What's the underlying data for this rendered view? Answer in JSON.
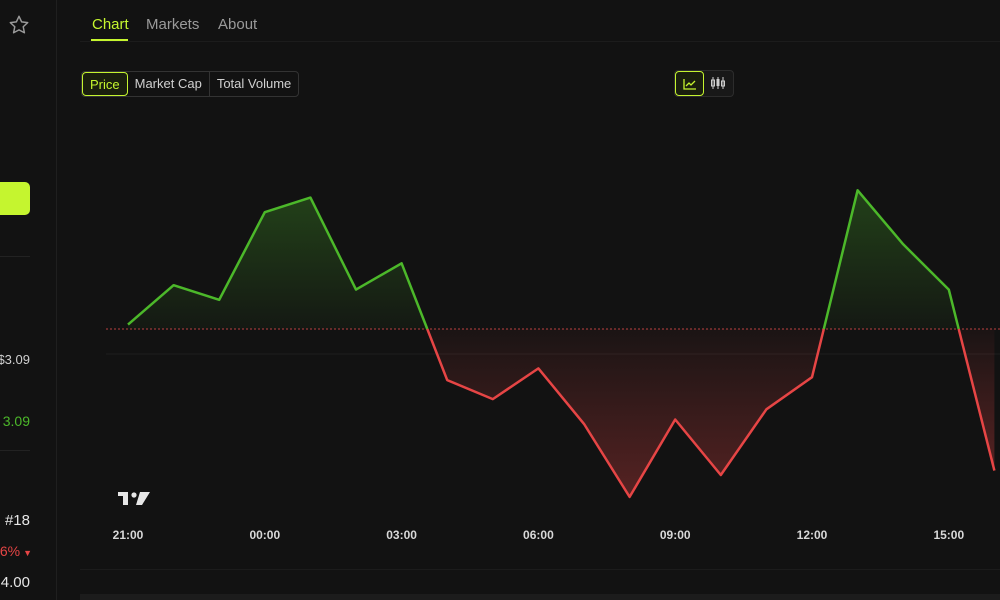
{
  "tabs": [
    {
      "label": "Chart",
      "active": true
    },
    {
      "label": "Markets",
      "active": false
    },
    {
      "label": "About",
      "active": false
    }
  ],
  "metric_toggle": [
    {
      "label": "Price",
      "active": true
    },
    {
      "label": "Market Cap",
      "active": false
    },
    {
      "label": "Total Volume",
      "active": false
    }
  ],
  "chart_type_toggle": {
    "line_icon": "line-chart-icon",
    "candle_icon": "candlestick-icon",
    "active": "line"
  },
  "sidebar": {
    "price_low": "$3.09",
    "price_high": "3.09",
    "rank": "#18",
    "change": "6%",
    "last_value": "4.00"
  },
  "colors": {
    "accent": "#c5f52f",
    "up": "#4cb82a",
    "down": "#e64545",
    "baseline": "#b94040"
  },
  "chart_data": {
    "type": "line",
    "x_labels": [
      "21:00",
      "00:00",
      "03:00",
      "06:00",
      "09:00",
      "12:00",
      "15:00"
    ],
    "baseline": 0,
    "note_baseline_style": "dotted",
    "x": [
      0,
      1,
      2,
      3,
      4,
      5,
      6,
      7,
      8,
      9,
      10,
      11,
      12,
      13,
      14,
      15,
      16,
      17,
      18,
      19
    ],
    "values": [
      0.03,
      0.3,
      0.2,
      0.8,
      0.9,
      0.27,
      0.45,
      -0.35,
      -0.48,
      -0.27,
      -0.65,
      -1.15,
      -0.62,
      -1.0,
      -0.55,
      -0.33,
      0.95,
      0.58,
      0.27,
      -0.97
    ],
    "ylim": [
      -1.5,
      1.5
    ]
  }
}
